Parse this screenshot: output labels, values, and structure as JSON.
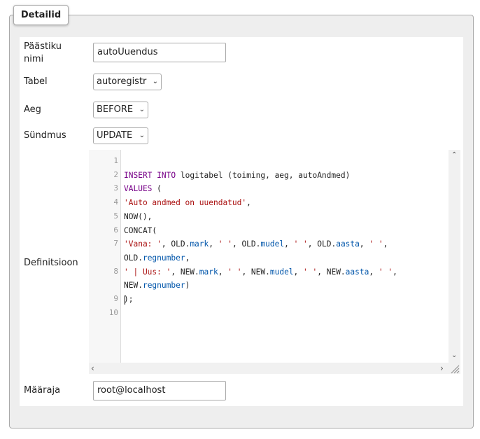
{
  "legend": "Detailid",
  "fields": {
    "name_label": "Päästiku nimi",
    "name_value": "autoUuendus",
    "table_label": "Tabel",
    "table_value": "autoregistr",
    "time_label": "Aeg",
    "time_value": "BEFORE",
    "event_label": "Sündmus",
    "event_value": "UPDATE",
    "definition_label": "Definitsioon",
    "definer_label": "Määraja",
    "definer_value": "root@localhost"
  },
  "editor": {
    "line_numbers": [
      "1",
      "2",
      "3",
      "4",
      "5",
      "6",
      "7",
      "",
      "8",
      "",
      "9",
      "10"
    ],
    "lines": [
      [],
      [
        [
          "kw",
          "INSERT"
        ],
        [
          "t",
          " "
        ],
        [
          "kw",
          "INTO"
        ],
        [
          "t",
          " logitabel (toiming, aeg, autoAndmed)"
        ]
      ],
      [
        [
          "kw",
          "VALUES"
        ],
        [
          "t",
          " ("
        ]
      ],
      [
        [
          "str",
          "'Auto andmed on uuendatud'"
        ],
        [
          "t",
          ","
        ]
      ],
      [
        [
          "t",
          "NOW(),"
        ]
      ],
      [
        [
          "t",
          "CONCAT("
        ]
      ],
      [
        [
          "str",
          "'Vana: '"
        ],
        [
          "t",
          ", OLD."
        ],
        [
          "fld",
          "mark"
        ],
        [
          "t",
          ", "
        ],
        [
          "str",
          "' '"
        ],
        [
          "t",
          ", OLD."
        ],
        [
          "fld",
          "mudel"
        ],
        [
          "t",
          ", "
        ],
        [
          "str",
          "' '"
        ],
        [
          "t",
          ", OLD."
        ],
        [
          "fld",
          "aasta"
        ],
        [
          "t",
          ", "
        ],
        [
          "str",
          "' '"
        ],
        [
          "t",
          ","
        ]
      ],
      [
        [
          "t",
          "OLD."
        ],
        [
          "fld",
          "regnumber"
        ],
        [
          "t",
          ","
        ]
      ],
      [
        [
          "str",
          "' | Uus: '"
        ],
        [
          "t",
          ", NEW."
        ],
        [
          "fld",
          "mark"
        ],
        [
          "t",
          ", "
        ],
        [
          "str",
          "' '"
        ],
        [
          "t",
          ", NEW."
        ],
        [
          "fld",
          "mudel"
        ],
        [
          "t",
          ", "
        ],
        [
          "str",
          "' '"
        ],
        [
          "t",
          ", NEW."
        ],
        [
          "fld",
          "aasta"
        ],
        [
          "t",
          ", "
        ],
        [
          "str",
          "' '"
        ],
        [
          "t",
          ","
        ]
      ],
      [
        [
          "t",
          "NEW."
        ],
        [
          "fld",
          "regnumber"
        ],
        [
          "t",
          ")"
        ]
      ],
      [
        [
          "t",
          ");"
        ]
      ],
      []
    ]
  },
  "icons": {
    "scroll_up": "chevron-up-icon",
    "scroll_down": "chevron-down-icon",
    "scroll_left": "chevron-left-icon",
    "scroll_right": "chevron-right-icon",
    "resize": "resize-grip-icon"
  }
}
